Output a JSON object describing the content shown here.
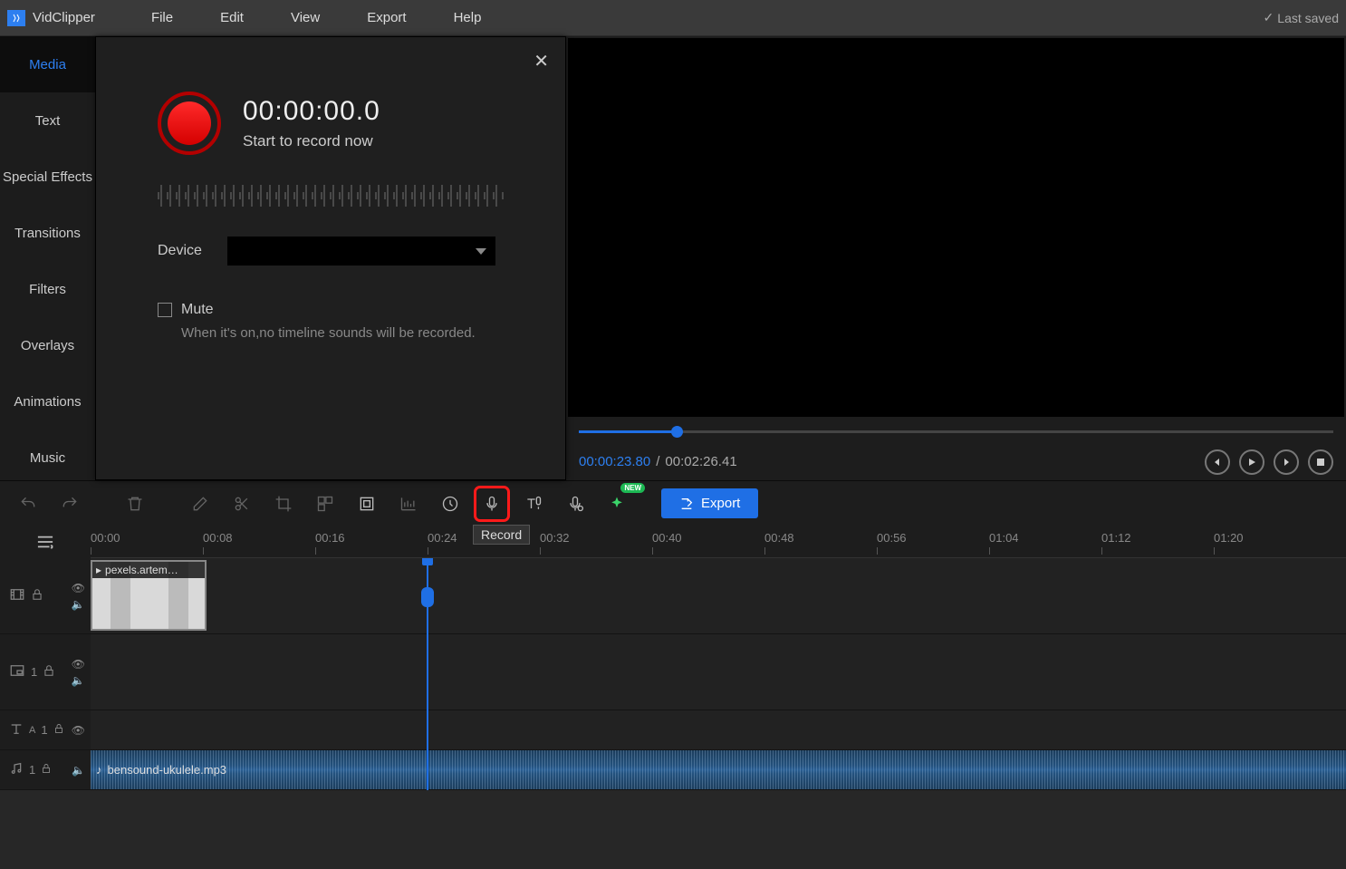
{
  "app": {
    "name": "VidClipper"
  },
  "menu": {
    "file": "File",
    "edit": "Edit",
    "view": "View",
    "export": "Export",
    "help": "Help"
  },
  "status": {
    "saved": "Last saved"
  },
  "sidebar": {
    "items": [
      {
        "label": "Media"
      },
      {
        "label": "Text"
      },
      {
        "label": "Special Effects"
      },
      {
        "label": "Transitions"
      },
      {
        "label": "Filters"
      },
      {
        "label": "Overlays"
      },
      {
        "label": "Animations"
      },
      {
        "label": "Music"
      }
    ]
  },
  "record_dialog": {
    "time": "00:00:00.0",
    "subtitle": "Start to record now",
    "device_label": "Device",
    "mute_label": "Mute",
    "mute_desc": "When it's on,no timeline sounds will be recorded."
  },
  "preview": {
    "current": "00:00:23.80",
    "sep": "/",
    "total": "00:02:26.41"
  },
  "toolbar": {
    "record_tooltip": "Record",
    "new_badge": "NEW",
    "export_label": "Export"
  },
  "ruler": {
    "ticks": [
      "00:00",
      "00:08",
      "00:16",
      "00:24",
      "00:32",
      "00:40",
      "00:48",
      "00:56",
      "01:04",
      "01:12",
      "01:20"
    ]
  },
  "tracks": {
    "video_clip_label": "pexels.artem…",
    "audio_clip_label": "bensound-ukulele.mp3",
    "pip_index": "1",
    "text_index": "1",
    "audio_index": "1"
  },
  "colors": {
    "accent": "#1F6FE5",
    "record_red": "#ff1a1a"
  }
}
